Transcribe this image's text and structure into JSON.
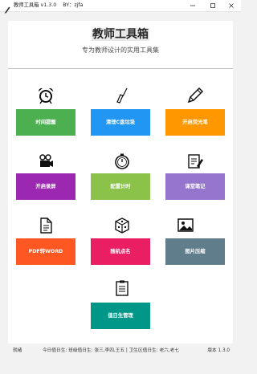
{
  "window": {
    "title": "教师工具箱 v1.3.0    BY：zjfa"
  },
  "header": {
    "title": "教师工具箱",
    "subtitle": "专为教师设计的实用工具集"
  },
  "tools": [
    {
      "icon": "alarm-clock-icon",
      "label": "时间提醒",
      "color": "#4caf50"
    },
    {
      "icon": "broom-icon",
      "label": "清理C盘垃圾",
      "color": "#2196f3"
    },
    {
      "icon": "pencil-icon",
      "label": "开启荧光笔",
      "color": "#ff9800"
    },
    {
      "icon": "camera-icon",
      "label": "开启录屏",
      "color": "#9c27b0"
    },
    {
      "icon": "timer-icon",
      "label": "配置计时",
      "color": "#8bc34a"
    },
    {
      "icon": "notes-icon",
      "label": "课堂笔记",
      "color": "#9575cd"
    },
    {
      "icon": "document-icon",
      "label": "PDF转WORD",
      "color": "#ff5722"
    },
    {
      "icon": "dice-icon",
      "label": "随机点名",
      "color": "#e91e63"
    },
    {
      "icon": "image-icon",
      "label": "图片压缩",
      "color": "#607d8b"
    },
    {
      "icon": "clipboard-icon",
      "label": "值日生管理",
      "color": "#009688"
    }
  ],
  "status": {
    "ready": "就绪",
    "duty": "今日值日生: 班级值日生: 张三,李四,王五 | 卫生区值日生: 老六,老七",
    "version": "版本 1.3.0"
  }
}
